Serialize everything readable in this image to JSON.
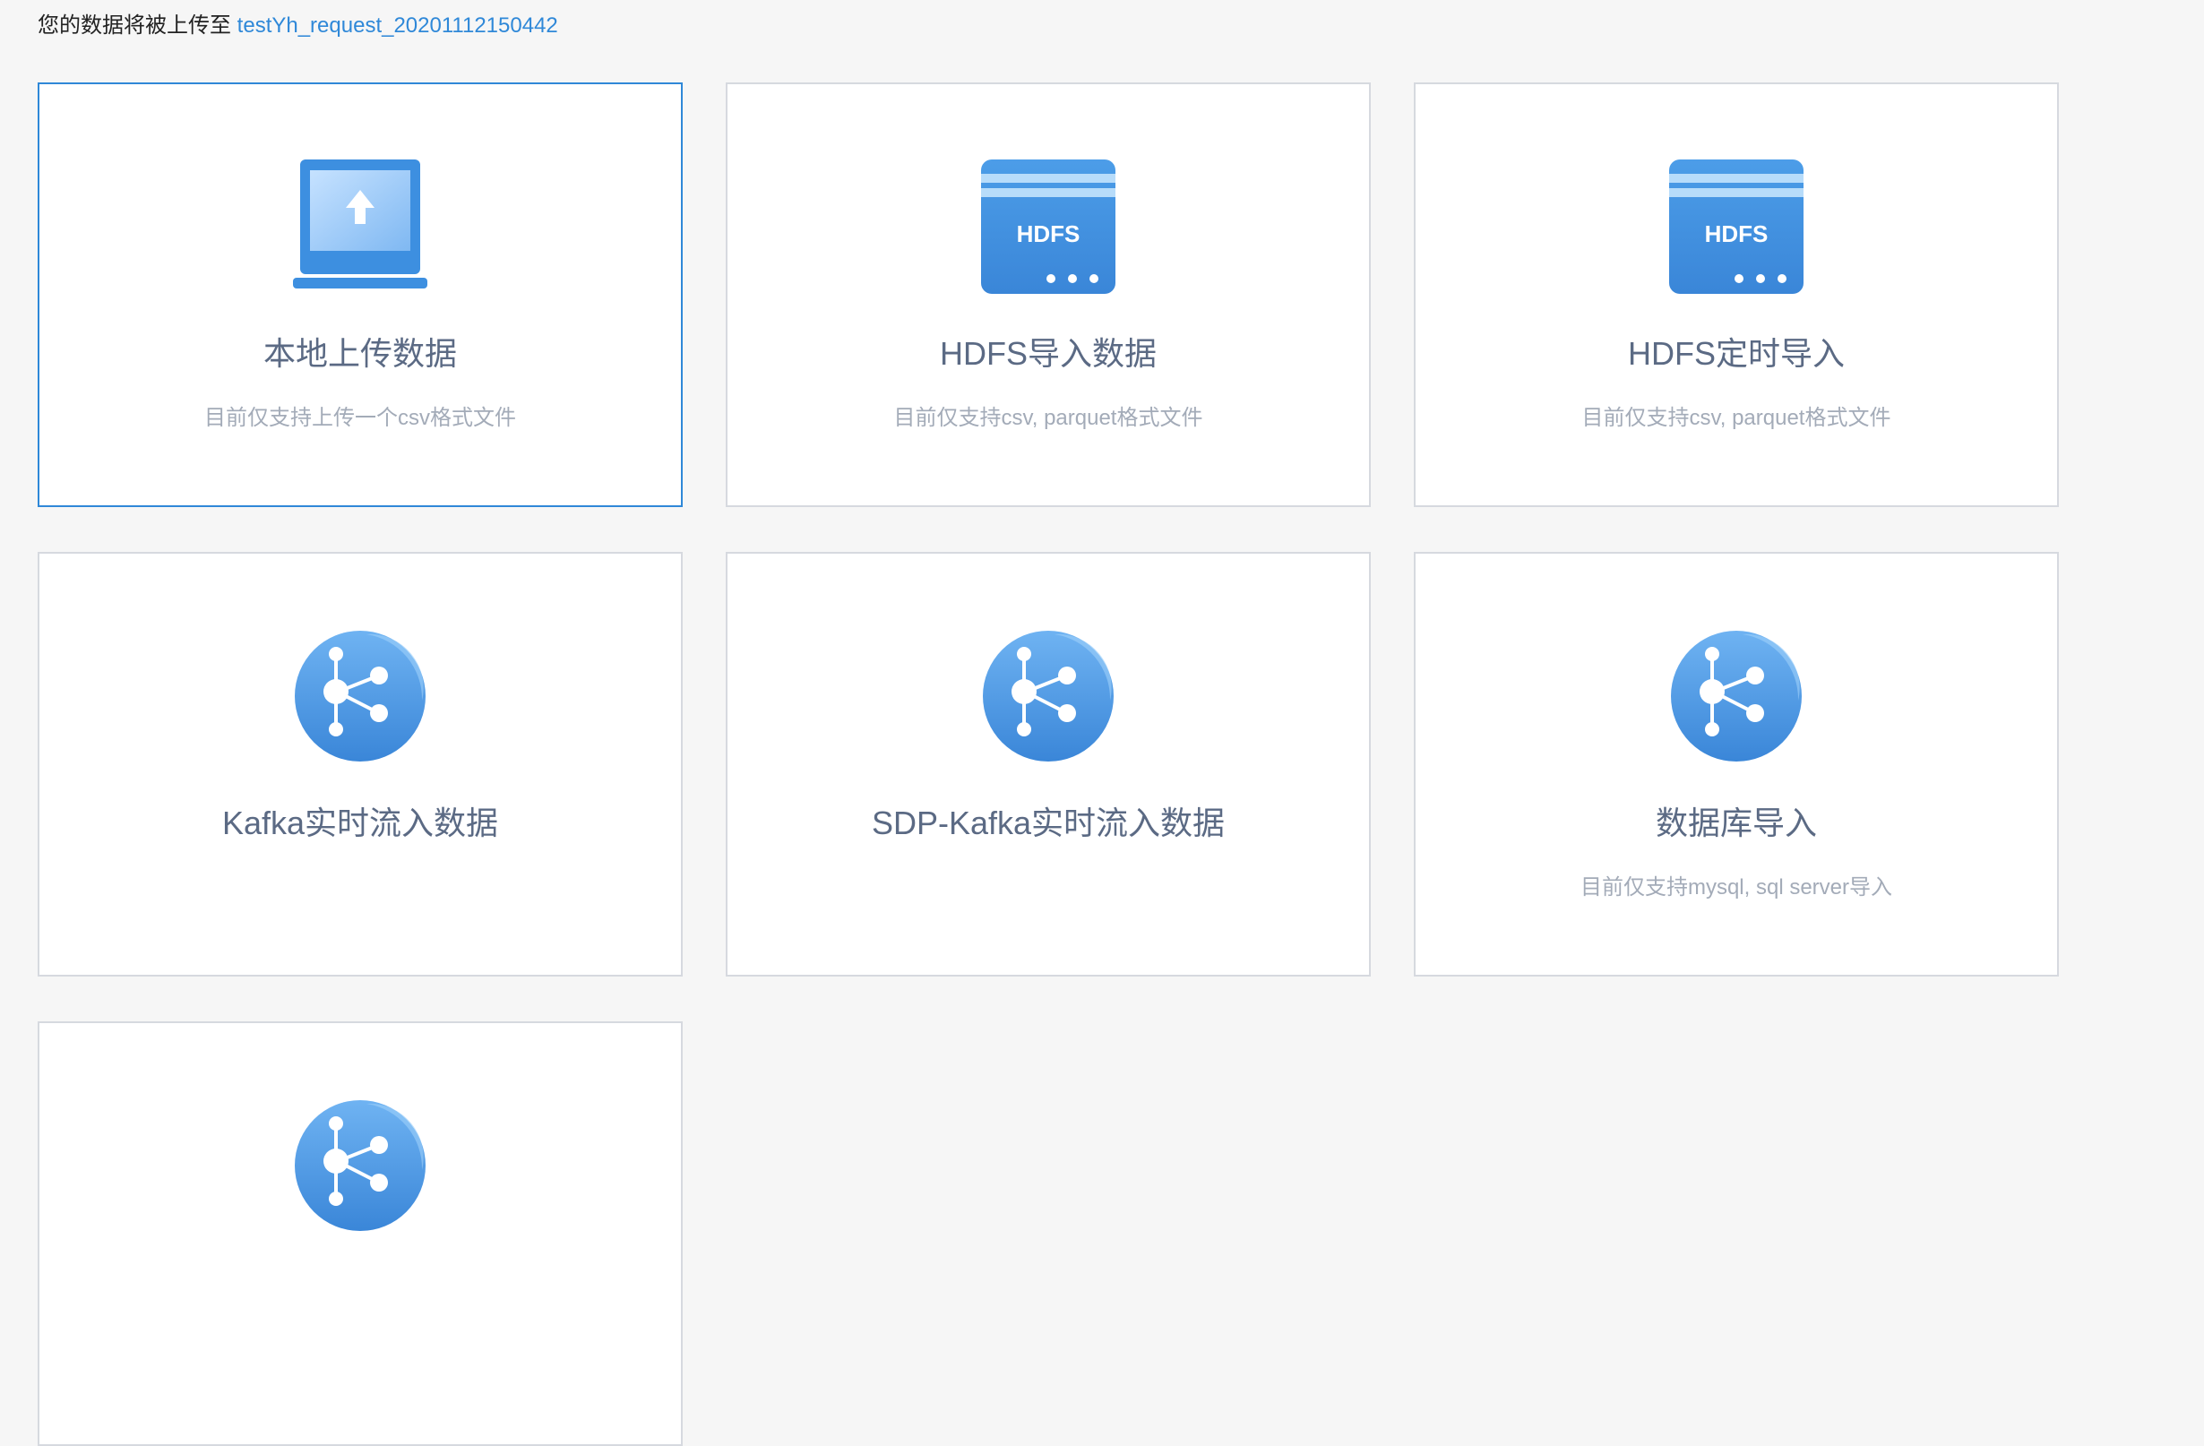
{
  "header": {
    "prefix": "您的数据将被上传至",
    "target_link": "testYh_request_20201112150442"
  },
  "colors": {
    "accent": "#2f88d8",
    "icon_blue": "#3d8fe0",
    "title_text": "#5b6a84",
    "desc_text": "#a3abb8"
  },
  "cards": [
    {
      "title": "本地上传数据",
      "desc": "目前仅支持上传一个csv格式文件",
      "icon": "laptop-upload-icon"
    },
    {
      "title": "HDFS导入数据",
      "desc": "目前仅支持csv, parquet格式文件",
      "icon": "hdfs-server-icon",
      "icon_label": "HDFS"
    },
    {
      "title": "HDFS定时导入",
      "desc": "目前仅支持csv, parquet格式文件",
      "icon": "hdfs-server-icon",
      "icon_label": "HDFS"
    },
    {
      "title": "Kafka实时流入数据",
      "desc": "",
      "icon": "kafka-network-icon"
    },
    {
      "title": "SDP-Kafka实时流入数据",
      "desc": "",
      "icon": "kafka-network-icon"
    },
    {
      "title": "数据库导入",
      "desc": "目前仅支持mysql, sql server导入",
      "icon": "kafka-network-icon"
    },
    {
      "title": "",
      "desc": "",
      "icon": "kafka-network-icon"
    }
  ]
}
